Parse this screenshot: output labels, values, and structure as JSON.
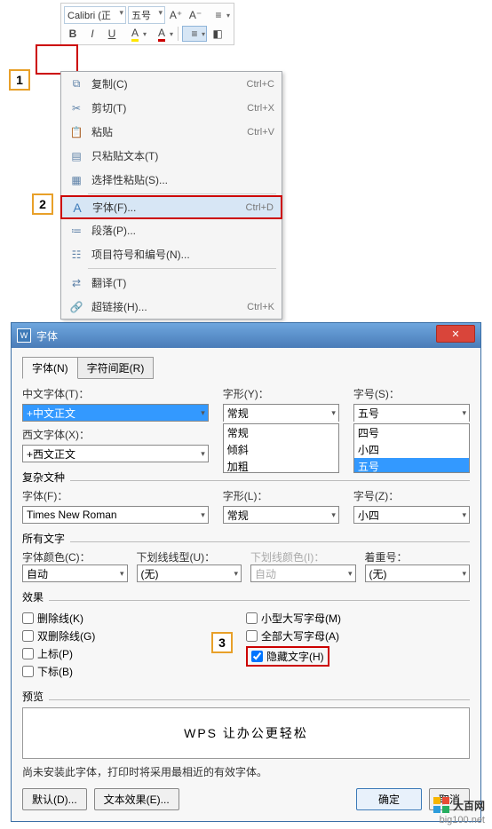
{
  "toolbar": {
    "font": "Calibri (正",
    "size": "五号",
    "bold": "B",
    "italic": "I",
    "underline": "U"
  },
  "callouts": {
    "c1": "1",
    "c2": "2",
    "c3": "3"
  },
  "context": {
    "copy": {
      "label": "复制(C)",
      "sc": "Ctrl+C"
    },
    "cut": {
      "label": "剪切(T)",
      "sc": "Ctrl+X"
    },
    "paste": {
      "label": "粘贴",
      "sc": "Ctrl+V"
    },
    "pasteText": {
      "label": "只粘贴文本(T)"
    },
    "pasteSpecial": {
      "label": "选择性粘贴(S)..."
    },
    "font": {
      "label": "字体(F)...",
      "sc": "Ctrl+D"
    },
    "paragraph": {
      "label": "段落(P)..."
    },
    "bullets": {
      "label": "项目符号和编号(N)..."
    },
    "translate": {
      "label": "翻译(T)"
    },
    "hyperlink": {
      "label": "超链接(H)...",
      "sc": "Ctrl+K"
    }
  },
  "dialog": {
    "title": "字体",
    "tabs": {
      "t1": "字体(N)",
      "t2": "字符间距(R)"
    },
    "cnFontLbl": "中文字体(T)：",
    "cnFont": "+中文正文",
    "styleLbl": "字形(Y)：",
    "style": "常规",
    "styleOpts": [
      "常规",
      "倾斜",
      "加粗"
    ],
    "sizeLbl": "字号(S)：",
    "size": "五号",
    "sizeOpts": [
      "四号",
      "小四",
      "五号"
    ],
    "enFontLbl": "西文字体(X)：",
    "enFont": "+西文正文",
    "complexLbl": "复杂文种",
    "cFontLbl": "字体(F)：",
    "cFont": "Times New Roman",
    "cStyleLbl": "字形(L)：",
    "cStyle": "常规",
    "cSizeLbl": "字号(Z)：",
    "cSize": "小四",
    "allTextLbl": "所有文字",
    "colorLbl": "字体颜色(C)：",
    "color": "自动",
    "ulineLbl": "下划线线型(U)：",
    "uline": "(无)",
    "ucolorLbl": "下划线颜色(I)：",
    "ucolor": "自动",
    "emphLbl": "着重号：",
    "emph": "(无)",
    "effectsLbl": "效果",
    "e1": "删除线(K)",
    "e2": "双删除线(G)",
    "e3": "上标(P)",
    "e4": "下标(B)",
    "e5": "小型大写字母(M)",
    "e6": "全部大写字母(A)",
    "e7": "隐藏文字(H)",
    "previewLbl": "预览",
    "previewText": "WPS 让办公更轻松",
    "note": "尚未安装此字体，打印时将采用最相近的有效字体。",
    "btnDefault": "默认(D)...",
    "btnTextFx": "文本效果(E)...",
    "btnOk": "确定",
    "btnCancel": "取消"
  },
  "watermark": {
    "brand": "大百网",
    "url": "big100.net"
  }
}
